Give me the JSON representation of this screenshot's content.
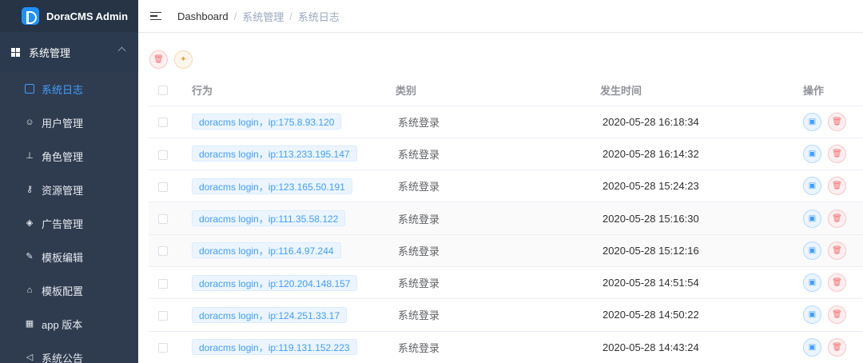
{
  "brand": {
    "title": "DoraCMS Admin"
  },
  "sidebar": {
    "group": {
      "label": "系统管理"
    },
    "items": [
      {
        "label": "系统日志",
        "icon": "calendar-icon",
        "glyph": "",
        "active": true
      },
      {
        "label": "用户管理",
        "icon": "user-icon",
        "glyph": "☺"
      },
      {
        "label": "角色管理",
        "icon": "hierarchy-icon",
        "glyph": "⊥"
      },
      {
        "label": "资源管理",
        "icon": "key-icon",
        "glyph": "⚷"
      },
      {
        "label": "广告管理",
        "icon": "tag-icon",
        "glyph": "◈"
      },
      {
        "label": "模板编辑",
        "icon": "edit-icon",
        "glyph": "✎"
      },
      {
        "label": "模板配置",
        "icon": "shirt-icon",
        "glyph": "⌂"
      },
      {
        "label": "app 版本",
        "icon": "grid-icon",
        "glyph": "▦"
      },
      {
        "label": "系统公告",
        "icon": "speaker-icon",
        "glyph": "◁"
      }
    ]
  },
  "topbar": {
    "breadcrumb": [
      "Dashboard",
      "系统管理",
      "系统日志"
    ],
    "separator": "/"
  },
  "table": {
    "headers": {
      "action": "行为",
      "category": "类别",
      "time": "发生时间",
      "ops": "操作"
    },
    "rows": [
      {
        "action": "doracms login，ip:175.8.93.120",
        "category": "系统登录",
        "time": "2020-05-28 16:18:34"
      },
      {
        "action": "doracms login，ip:113.233.195.147",
        "category": "系统登录",
        "time": "2020-05-28 16:14:32"
      },
      {
        "action": "doracms login，ip:123.165.50.191",
        "category": "系统登录",
        "time": "2020-05-28 15:24:23"
      },
      {
        "action": "doracms login，ip:111.35.58.122",
        "category": "系统登录",
        "time": "2020-05-28 15:16:30"
      },
      {
        "action": "doracms login，ip:116.4.97.244",
        "category": "系统登录",
        "time": "2020-05-28 15:12:16"
      },
      {
        "action": "doracms login，ip:120.204.148.157",
        "category": "系统登录",
        "time": "2020-05-28 14:51:54"
      },
      {
        "action": "doracms login，ip:124.251.33.17",
        "category": "系统登录",
        "time": "2020-05-28 14:50:22"
      },
      {
        "action": "doracms login，ip:119.131.152.223",
        "category": "系统登录",
        "time": "2020-05-28 14:43:24"
      }
    ]
  },
  "colors": {
    "sidebar_bg": "#2f3c4f",
    "accent": "#409eff",
    "danger": "#f56c6c",
    "warning": "#e6a23c"
  }
}
